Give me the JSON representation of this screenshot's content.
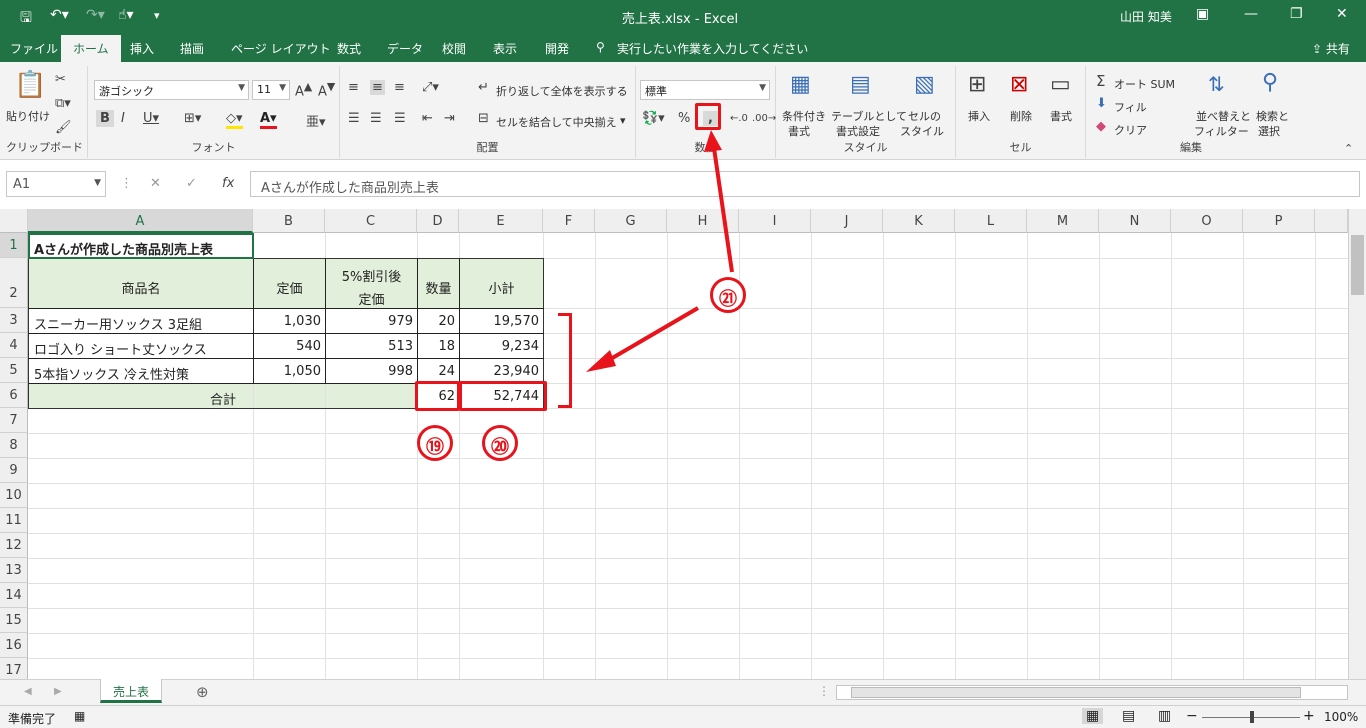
{
  "title_bar": {
    "title": "売上表.xlsx - Excel",
    "user": "山田 知美",
    "save_icon": "save-icon",
    "undo_icon": "undo-icon",
    "redo_icon": "redo-icon",
    "touch_icon": "touch-mode-icon",
    "customize_icon": "customize-qat-icon"
  },
  "tabs": [
    "ファイル",
    "ホーム",
    "挿入",
    "描画",
    "ページ レイアウト",
    "数式",
    "データ",
    "校閲",
    "表示",
    "開発"
  ],
  "active_tab": "ホーム",
  "tell_me": "実行したい作業を入力してください",
  "share": "共有",
  "ribbon": {
    "clipboard": {
      "label": "クリップボード",
      "paste": "貼り付け"
    },
    "font": {
      "label": "フォント",
      "font_name": "游ゴシック",
      "font_size": "11"
    },
    "alignment": {
      "label": "配置",
      "wrap": "折り返して全体を表示する",
      "merge": "セルを結合して中央揃え"
    },
    "number": {
      "label": "数値",
      "format": "標準",
      "percent": "%",
      "comma": ","
    },
    "styles": {
      "label": "スタイル",
      "cond_l1": "条件付き",
      "cond_l2": "書式",
      "table_l1": "テーブルとして",
      "table_l2": "書式設定",
      "cell_l1": "セルの",
      "cell_l2": "スタイル"
    },
    "cells": {
      "label": "セル",
      "insert": "挿入",
      "delete": "削除",
      "format": "書式"
    },
    "editing": {
      "label": "編集",
      "autosum": "オート SUM",
      "fill": "フィル",
      "clear": "クリア",
      "sort_l1": "並べ替えと",
      "sort_l2": "フィルター",
      "find_l1": "検索と",
      "find_l2": "選択"
    }
  },
  "formula_bar": {
    "name_box": "A1",
    "fx": "fx",
    "content": "Aさんが作成した商品別売上表"
  },
  "columns": [
    "A",
    "B",
    "C",
    "D",
    "E",
    "F",
    "G",
    "H",
    "I",
    "J",
    "K",
    "L",
    "M",
    "N",
    "O",
    "P"
  ],
  "rows": [
    "1",
    "2",
    "3",
    "4",
    "5",
    "6",
    "7",
    "8",
    "9",
    "10",
    "11",
    "12",
    "13",
    "14",
    "15",
    "16",
    "17"
  ],
  "cells": {
    "A1": "Aさんが作成した商品別売上表",
    "A2": "商品名",
    "B2": "定価",
    "C2a": "5%割引後",
    "C2b": "定価",
    "D2": "数量",
    "E2": "小計",
    "A3": "スニーカー用ソックス 3足組",
    "B3": "1,030",
    "C3": "979",
    "D3": "20",
    "E3": "19,570",
    "A4": "ロゴ入り ショート丈ソックス",
    "B4": "540",
    "C4": "513",
    "D4": "18",
    "E4": "9,234",
    "A5": "5本指ソックス 冷え性対策",
    "B5": "1,050",
    "C5": "998",
    "D5": "24",
    "E5": "23,940",
    "A6": "合計",
    "D6": "62",
    "E6": "52,744"
  },
  "annotations": {
    "n19": "⑲",
    "n20": "⑳",
    "n21": "㉑",
    "accent": "#e8131b"
  },
  "sheet_tab": "売上表",
  "status": {
    "ready": "準備完了",
    "zoom": "100%"
  }
}
